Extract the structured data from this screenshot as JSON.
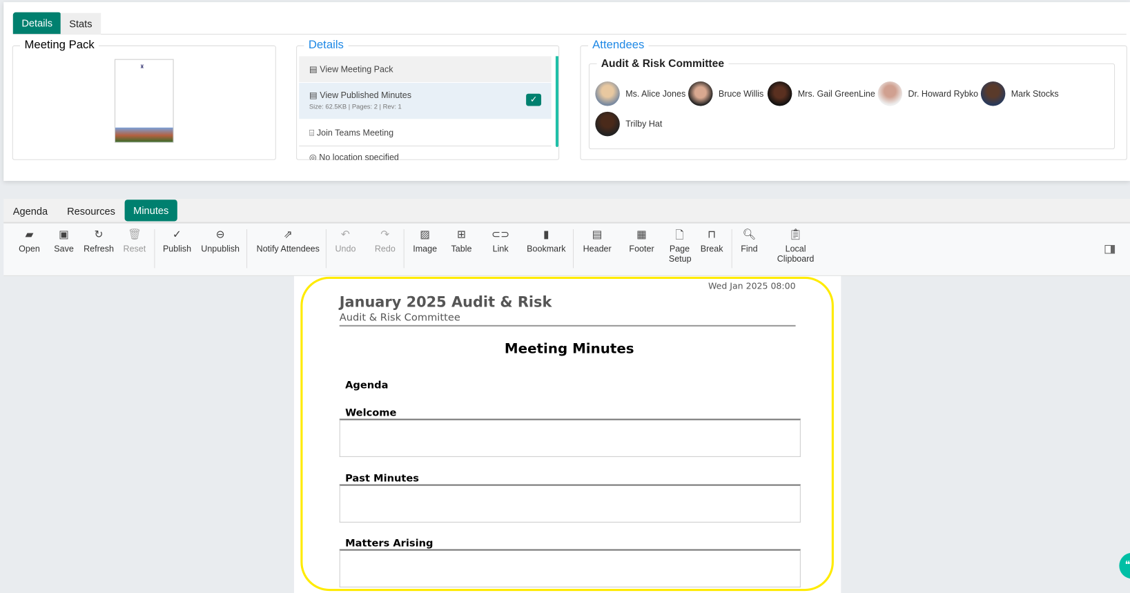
{
  "top_tabs": [
    {
      "label": "Details",
      "active": true
    },
    {
      "label": "Stats",
      "active": false
    }
  ],
  "meeting_pack": {
    "title": "Meeting Pack"
  },
  "details": {
    "title": "Details",
    "items": [
      {
        "label": "View Meeting Pack",
        "icon": "document-icon"
      },
      {
        "label": "View Published Minutes",
        "meta": "Size: 62.5KB | Pages: 2 | Rev: 1",
        "checked": true,
        "icon": "document-icon"
      },
      {
        "label": "Join Teams Meeting",
        "icon": "teams-icon"
      },
      {
        "label": "No location specified",
        "icon": "location-icon"
      }
    ]
  },
  "attendees": {
    "title": "Attendees",
    "committee": "Audit & Risk Committee",
    "people": [
      "Ms. Alice Jones",
      "Bruce Willis",
      "Mrs. Gail GreenLine",
      "Dr. Howard Rybko",
      "Mark Stocks",
      "Trilby Hat"
    ]
  },
  "bottom_tabs": [
    {
      "label": "Agenda"
    },
    {
      "label": "Resources"
    },
    {
      "label": "Minutes",
      "active": true
    }
  ],
  "toolbar": [
    "Open",
    "Save",
    "Refresh",
    "Reset",
    "Publish",
    "Unpublish",
    "Notify Attendees",
    "Undo",
    "Redo",
    "Image",
    "Table",
    "Link",
    "Bookmark",
    "Header",
    "Footer",
    "Page Setup",
    "Break",
    "Find",
    "Local Clipboard"
  ],
  "document": {
    "date": "Wed Jan 2025 08:00",
    "title": "January 2025 Audit & Risk",
    "subtitle": "Audit & Risk Committee",
    "heading": "Meeting Minutes",
    "agenda_label": "Agenda",
    "sections": [
      "Welcome",
      "Past Minutes",
      "Matters Arising"
    ]
  },
  "colors": {
    "accent": "#00806f",
    "highlight": "#ffeb00",
    "link": "#1e88e5"
  }
}
